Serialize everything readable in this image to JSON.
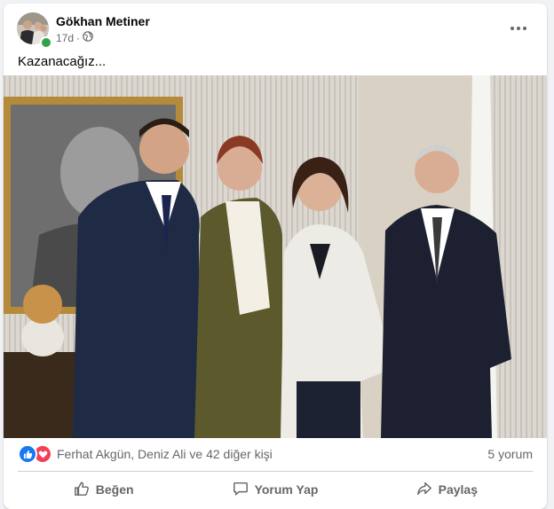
{
  "post": {
    "author": "Gökhan Metiner",
    "time": "17d",
    "privacy_icon": "globe-icon",
    "text": "Kazanacağız..."
  },
  "reactions": {
    "icons": [
      "like-icon",
      "love-icon"
    ],
    "names": "Ferhat Akgün, Deniz Ali ve 42 diğer kişi",
    "comments": "5 yorum"
  },
  "actions": {
    "like": "Beğen",
    "comment": "Yorum Yap",
    "share": "Paylaş"
  },
  "colors": {
    "like_blue": "#1877f2",
    "love_red": "#f33e58",
    "online_green": "#31a24c",
    "secondary_text": "#65676b"
  }
}
